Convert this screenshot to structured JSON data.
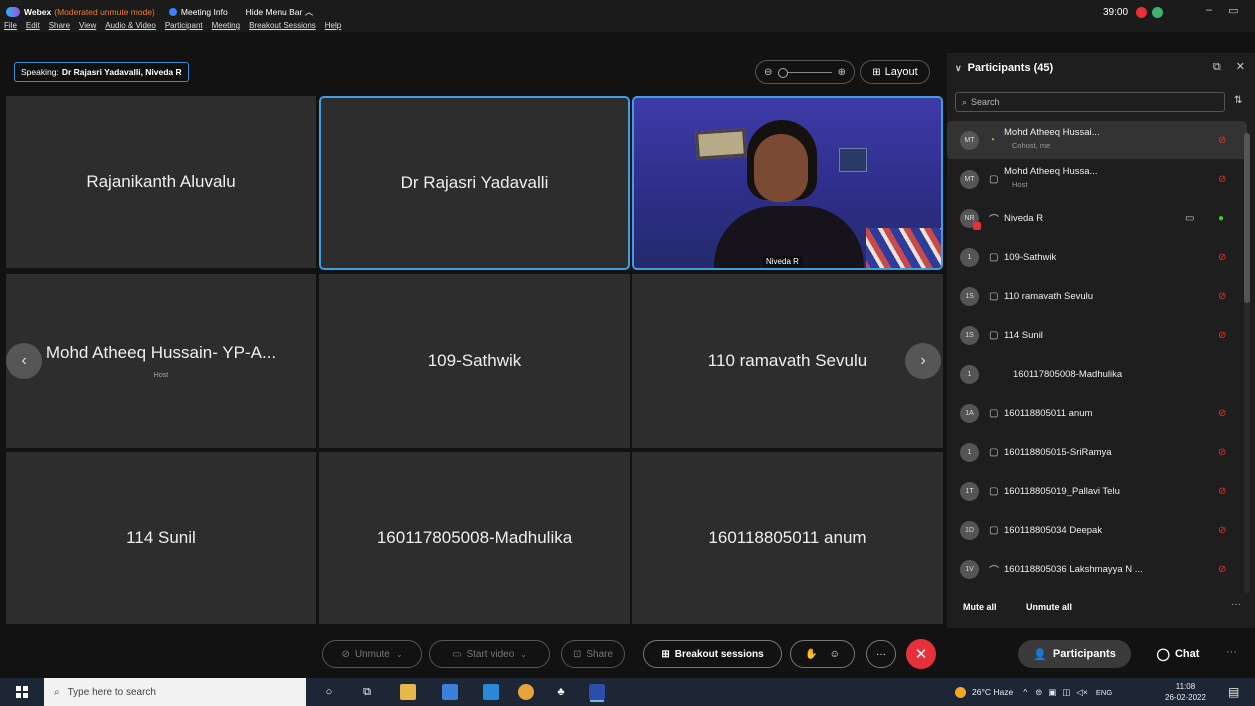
{
  "titlebar": {
    "app_name": "Webex",
    "mode": "(Moderated unmute mode)",
    "meeting_info": "Meeting Info",
    "hide_menu": "Hide Menu Bar",
    "hide_menu_icon": "chevron-up-icon",
    "timer": "39:00"
  },
  "menu": [
    "File",
    "Edit",
    "Share",
    "View",
    "Audio & Video",
    "Participant",
    "Meeting",
    "Breakout Sessions",
    "Help"
  ],
  "speaking": {
    "label": "Speaking:",
    "names": "Dr Rajasri Yadavalli, Niveda R"
  },
  "layout_button": "Layout",
  "tiles": [
    {
      "name": "Rajanikanth Aluvalu",
      "sub": ""
    },
    {
      "name": "Dr Rajasri Yadavalli",
      "sub": ""
    },
    {
      "name": "Niveda R",
      "sub": ""
    },
    {
      "name": "Mohd Atheeq Hussain- YP-A...",
      "sub": "Host"
    },
    {
      "name": "109-Sathwik",
      "sub": ""
    },
    {
      "name": "110 ramavath Sevulu",
      "sub": ""
    },
    {
      "name": "114 Sunil",
      "sub": ""
    },
    {
      "name": "160117805008-Madhulika",
      "sub": ""
    },
    {
      "name": "160118805011 anum",
      "sub": ""
    }
  ],
  "participants": {
    "title": "Participants (45)",
    "search_placeholder": "Search",
    "mute_all": "Mute all",
    "unmute_all": "Unmute all",
    "list": [
      {
        "initials": "MT",
        "name": "Mohd Atheeq Hussai...",
        "role": "Cohost, me",
        "mic_muted": true
      },
      {
        "initials": "MT",
        "name": "Mohd Atheeq Hussa...",
        "role": "Host",
        "mic_muted": true
      },
      {
        "initials": "NR",
        "name": "Niveda R",
        "role": "",
        "mic_muted": false
      },
      {
        "initials": "1",
        "name": "109-Sathwik",
        "role": "",
        "mic_muted": true
      },
      {
        "initials": "1S",
        "name": "110 ramavath Sevulu",
        "role": "",
        "mic_muted": true
      },
      {
        "initials": "1S",
        "name": "114 Sunil",
        "role": "",
        "mic_muted": true
      },
      {
        "initials": "1",
        "name": "160117805008-Madhulika",
        "role": "",
        "mic_muted": false
      },
      {
        "initials": "1A",
        "name": "160118805011 anum",
        "role": "",
        "mic_muted": true
      },
      {
        "initials": "1",
        "name": "160118805015-SriRamya",
        "role": "",
        "mic_muted": true
      },
      {
        "initials": "1T",
        "name": "160118805019_Pallavi Telu",
        "role": "",
        "mic_muted": true
      },
      {
        "initials": "1D",
        "name": "160118805034 Deepak",
        "role": "",
        "mic_muted": true
      },
      {
        "initials": "1V",
        "name": "160118805036 Lakshmayya N ...",
        "role": "",
        "mic_muted": true
      }
    ]
  },
  "controls": {
    "unmute": "Unmute",
    "start_video": "Start video",
    "share": "Share",
    "breakout": "Breakout sessions",
    "participants_tab": "Participants",
    "chat_tab": "Chat"
  },
  "taskbar": {
    "search_placeholder": "Type here to search",
    "weather": "26°C Haze",
    "lang": "ENG",
    "time": "11:08",
    "date": "26-02-2022"
  },
  "colors": {
    "accent": "#3f9ee0",
    "danger": "#e8303a",
    "mode": "#f27b32"
  }
}
